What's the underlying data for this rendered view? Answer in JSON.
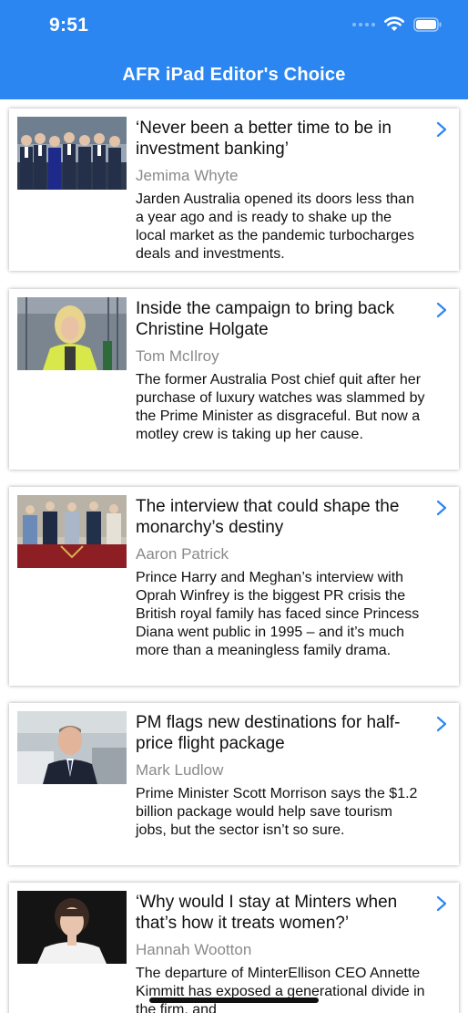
{
  "status_bar": {
    "time": "9:51",
    "signal_icon": "cellular-signal-icon",
    "wifi_icon": "wifi-icon",
    "battery_icon": "battery-icon"
  },
  "header": {
    "title": "AFR iPad Editor's Choice",
    "background_color": "#2b86f2"
  },
  "accent_color": "#2b86f2",
  "articles": [
    {
      "headline": "‘Never been a better time to be in investment banking’",
      "author": "Jemima Whyte",
      "summary": "Jarden Australia opened its doors less than a year ago and is ready to shake up the local market as the pandemic turbocharges deals and investments."
    },
    {
      "headline": "Inside the campaign to bring back Christine Holgate",
      "author": "Tom McIlroy",
      "summary": "The former Australia Post chief quit after her purchase of luxury watches was slammed by the Prime Minister as disgraceful. But now a motley crew is taking up her cause."
    },
    {
      "headline": "The interview that could shape the monarchy’s destiny",
      "author": "Aaron Patrick",
      "summary": "Prince Harry and Meghan’s interview with Oprah Winfrey is the biggest PR crisis the British royal family has faced since Princess Diana went public in 1995 – and it’s much more than a meaningless family drama."
    },
    {
      "headline": "PM flags new destinations for half-price flight package",
      "author": "Mark Ludlow",
      "summary": "Prime Minister Scott Morrison says the $1.2 billion package would help save tourism jobs, but the sector isn’t so sure."
    },
    {
      "headline": "‘Why would I stay at Minters when that’s how it treats women?’",
      "author": "Hannah Wootton",
      "summary": "The departure of MinterEllison CEO Annette Kimmitt has exposed a generational divide in the firm, and"
    }
  ]
}
